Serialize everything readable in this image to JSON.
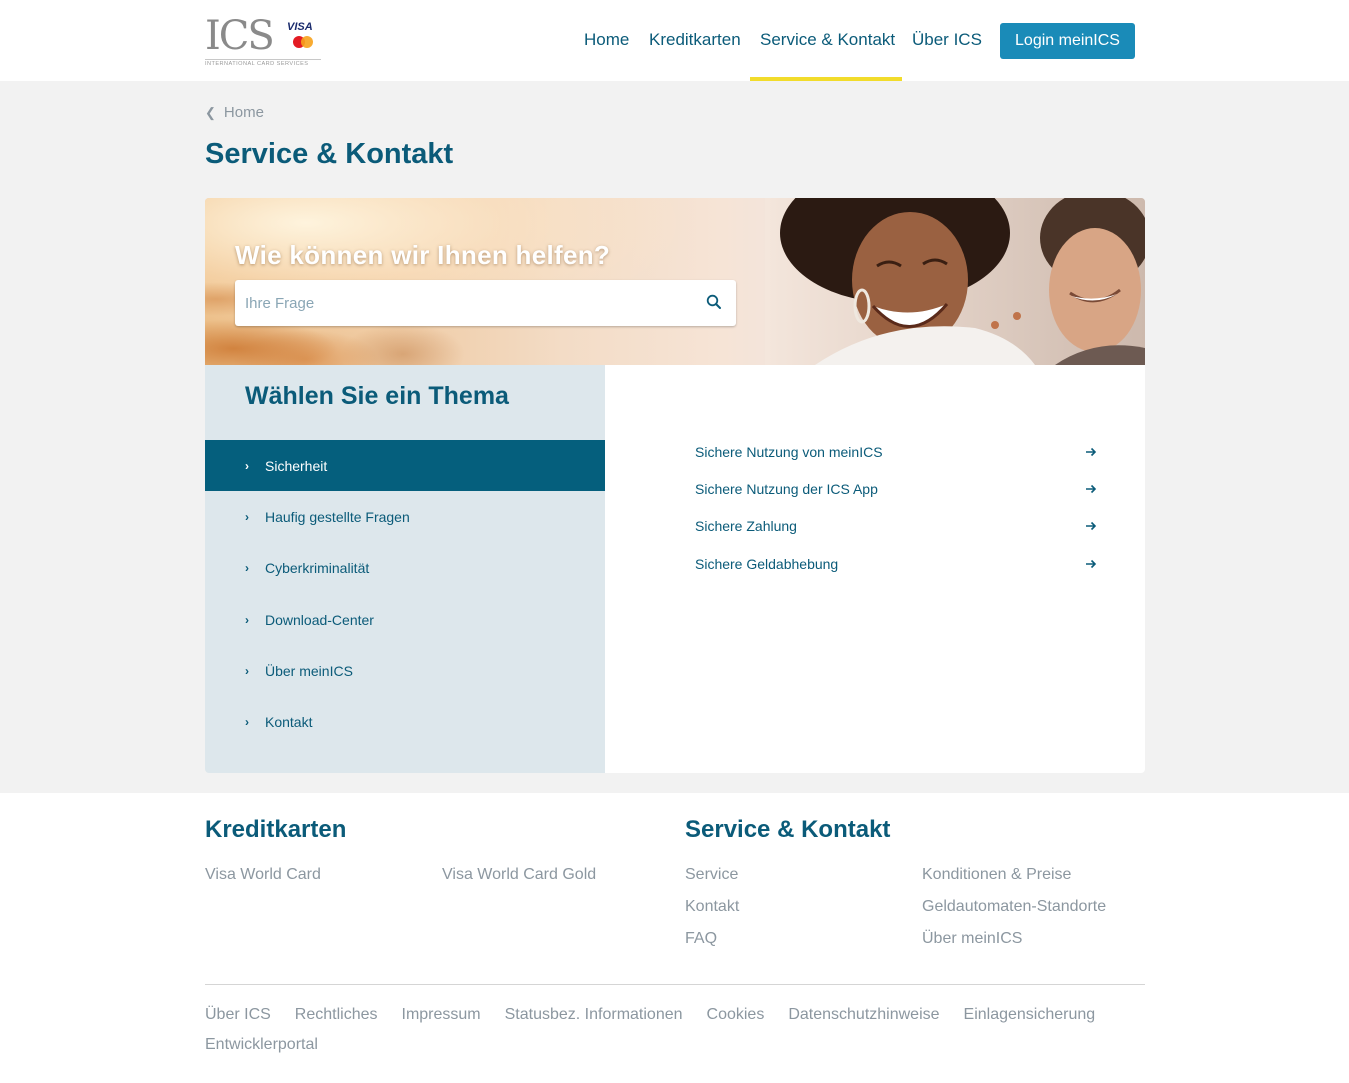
{
  "logo": {
    "text": "ICS",
    "visa": "VISA",
    "tagline": "INTERNATIONAL CARD SERVICES"
  },
  "nav": {
    "items": [
      {
        "label": "Home"
      },
      {
        "label": "Kreditkarten"
      },
      {
        "label": "Service & Kontakt",
        "active": true
      },
      {
        "label": "Über ICS"
      }
    ],
    "login_label": "Login meinICS"
  },
  "breadcrumb": {
    "label": "Home"
  },
  "page_title": "Service & Kontakt",
  "hero": {
    "heading": "Wie können wir Ihnen helfen?",
    "search_placeholder": "Ihre Frage"
  },
  "topics": {
    "heading": "Wählen Sie ein Thema",
    "items": [
      {
        "label": "Sicherheit",
        "active": true
      },
      {
        "label": "Haufig gestellte Fragen"
      },
      {
        "label": "Cyberkriminalität"
      },
      {
        "label": "Download-Center"
      },
      {
        "label": "Über meinICS"
      },
      {
        "label": "Kontakt"
      }
    ]
  },
  "topic_links": [
    {
      "label": "Sichere Nutzung von meinICS"
    },
    {
      "label": "Sichere Nutzung der ICS App"
    },
    {
      "label": "Sichere Zahlung"
    },
    {
      "label": "Sichere Geldabhebung"
    }
  ],
  "footer": {
    "kreditkarten": {
      "title": "Kreditkarten",
      "links": [
        "Visa World Card",
        "Visa World Card Gold"
      ]
    },
    "service": {
      "title": "Service & Kontakt",
      "col1": [
        "Service",
        "Kontakt",
        "FAQ"
      ],
      "col2": [
        "Konditionen & Preise",
        "Geldautomaten-Standorte",
        "Über meinICS"
      ]
    },
    "bottom_links": [
      "Über ICS",
      "Rechtliches",
      "Impressum",
      "Statusbez. Informationen",
      "Cookies",
      "Datenschutzhinweise",
      "Einlagensicherung",
      "Entwicklerportal"
    ]
  },
  "colors": {
    "primary": "#0b5b79",
    "active_topic": "#055f7d",
    "login_button": "#1a8bb8",
    "nav_underline": "#f2dc2b",
    "muted_text": "#8c97a0",
    "topic_panel_bg": "#dde7ec",
    "page_bg": "#f2f2f2"
  },
  "icons": {
    "search": "search-icon",
    "breadcrumb": "chevron-left-icon",
    "topic_item": "chevron-right-icon",
    "link": "arrow-right-icon"
  }
}
